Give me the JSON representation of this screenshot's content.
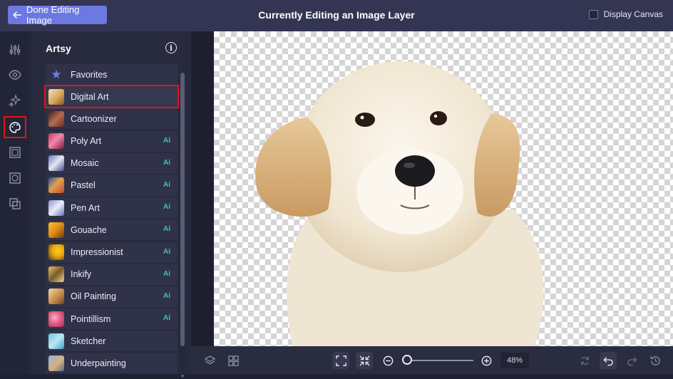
{
  "header": {
    "back_label": "Done Editing Image",
    "title": "Currently Editing an Image Layer",
    "display_canvas_label": "Display Canvas"
  },
  "rail": {
    "icons": [
      "sliders-icon",
      "eye-icon",
      "sparkles-icon",
      "palette-icon",
      "frame-icon",
      "texture-icon",
      "overlay-icon"
    ],
    "active": "palette-icon"
  },
  "panel": {
    "title": "Artsy",
    "items": [
      {
        "label": "Favorites",
        "ai": ""
      },
      {
        "label": "Digital Art",
        "ai": ""
      },
      {
        "label": "Cartoonizer",
        "ai": ""
      },
      {
        "label": "Poly Art",
        "ai": "Ai"
      },
      {
        "label": "Mosaic",
        "ai": "Ai"
      },
      {
        "label": "Pastel",
        "ai": "Ai"
      },
      {
        "label": "Pen Art",
        "ai": "Ai"
      },
      {
        "label": "Gouache",
        "ai": "Ai"
      },
      {
        "label": "Impressionist",
        "ai": "Ai"
      },
      {
        "label": "Inkify",
        "ai": "Ai"
      },
      {
        "label": "Oil Painting",
        "ai": "Ai"
      },
      {
        "label": "Pointillism",
        "ai": "Ai"
      },
      {
        "label": "Sketcher",
        "ai": ""
      },
      {
        "label": "Underpainting",
        "ai": ""
      }
    ],
    "selected": "Digital Art"
  },
  "bottombar": {
    "zoom": "48%",
    "zoom_fraction": 0.02
  },
  "colors": {
    "accent": "#6b79e0",
    "ai_badge": "#3fc9b0",
    "highlight": "#e3131b"
  }
}
